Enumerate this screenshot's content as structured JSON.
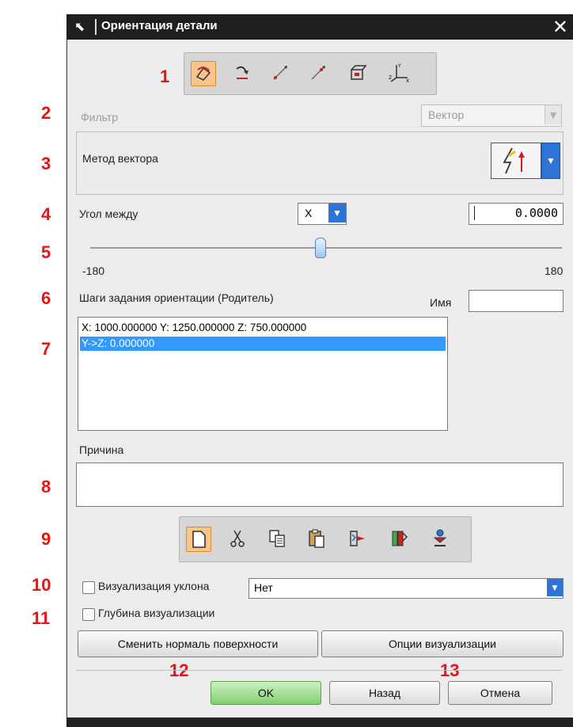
{
  "window": {
    "title": "Ориентация детали",
    "close_glyph": "✕"
  },
  "annotations": [
    "1",
    "2",
    "3",
    "4",
    "5",
    "6",
    "7",
    "8",
    "9",
    "10",
    "11",
    "12",
    "13"
  ],
  "orient_toolbar": {
    "icons": [
      "rotate-dynamic-icon",
      "rotate-vector-icon",
      "two-points-icon",
      "point-direction-icon",
      "face-normal-icon",
      "csys-icon"
    ]
  },
  "filter": {
    "label": "Фильтр",
    "value": "Вектор"
  },
  "vector_method": {
    "label": "Метод вектора"
  },
  "angle": {
    "label": "Угол между",
    "axis": "X",
    "value": "0.0000"
  },
  "slider": {
    "min_label": "-180",
    "max_label": "180",
    "value": 0
  },
  "steps": {
    "label": "Шаги задания ориентации (Родитель)",
    "name_label": "Имя",
    "name_value": "",
    "items": [
      "X: 1000.000000 Y: 1250.000000 Z: 750.000000",
      "Y->Z: 0.000000"
    ],
    "selected_index": 1
  },
  "reason": {
    "label": "Причина",
    "value": ""
  },
  "edit_toolbar": {
    "icons": [
      "new-page-icon",
      "cut-icon",
      "copy-icon",
      "paste-icon",
      "transfer-icon",
      "reorder-icon",
      "apply-icon"
    ]
  },
  "draft_vis": {
    "label": "Визуализация уклона",
    "value": "Нет",
    "checked": false
  },
  "depth_vis": {
    "label": "Глубина визуализации",
    "checked": false
  },
  "buttons": {
    "change_normal": "Сменить нормаль поверхности",
    "vis_options": "Опции визуализации",
    "ok": "OK",
    "back": "Назад",
    "cancel": "Отмена"
  },
  "colors": {
    "accent": "#3399ff",
    "annotation": "#e81414",
    "active_tool": "#f8c68c"
  }
}
